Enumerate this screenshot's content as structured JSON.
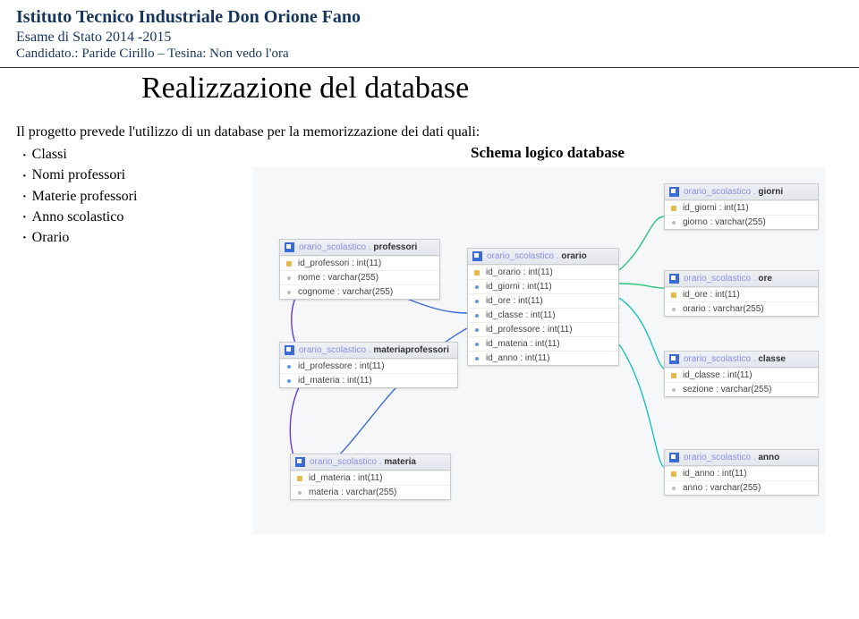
{
  "header": {
    "title": "Istituto Tecnico Industriale Don Orione Fano",
    "line2": "Esame di Stato 2014 -2015",
    "line3": "Candidato.: Paride Cirillo – Tesina: Non vedo l'ora"
  },
  "slide": {
    "title": "Realizzazione del database",
    "intro": "Il progetto prevede l'utilizzo di un database per la memorizzazione dei dati quali:",
    "bullets": [
      "Classi",
      "Nomi professori",
      "Materie professori",
      "Anno scolastico",
      "Orario"
    ],
    "schema_title": "Schema logico database"
  },
  "diagram": {
    "schema": "orario_scolastico .",
    "tables": {
      "giorni": {
        "name": "giorni",
        "cols": [
          {
            "k": "pk",
            "t": "id_giorni : int(11)"
          },
          {
            "k": "col",
            "t": "giorno : varchar(255)"
          }
        ]
      },
      "professori": {
        "name": "professori",
        "cols": [
          {
            "k": "pk",
            "t": "id_professori : int(11)"
          },
          {
            "k": "col",
            "t": "nome : varchar(255)"
          },
          {
            "k": "col",
            "t": "cognome : varchar(255)"
          }
        ]
      },
      "orario": {
        "name": "orario",
        "cols": [
          {
            "k": "pk",
            "t": "id_orario : int(11)"
          },
          {
            "k": "fk",
            "t": "id_giorni : int(11)"
          },
          {
            "k": "fk",
            "t": "id_ore : int(11)"
          },
          {
            "k": "fk",
            "t": "id_classe : int(11)"
          },
          {
            "k": "fk",
            "t": "id_professore : int(11)"
          },
          {
            "k": "fk",
            "t": "id_materia : int(11)"
          },
          {
            "k": "fk",
            "t": "id_anno : int(11)"
          }
        ]
      },
      "ore": {
        "name": "ore",
        "cols": [
          {
            "k": "pk",
            "t": "id_ore : int(11)"
          },
          {
            "k": "col",
            "t": "orario : varchar(255)"
          }
        ]
      },
      "materiaprofessori": {
        "name": "materiaprofessori",
        "cols": [
          {
            "k": "fk",
            "t": "id_professore : int(11)"
          },
          {
            "k": "fk",
            "t": "id_materia : int(11)"
          }
        ]
      },
      "classe": {
        "name": "classe",
        "cols": [
          {
            "k": "pk",
            "t": "id_classe : int(11)"
          },
          {
            "k": "col",
            "t": "sezione : varchar(255)"
          }
        ]
      },
      "materia": {
        "name": "materia",
        "cols": [
          {
            "k": "pk",
            "t": "id_materia : int(11)"
          },
          {
            "k": "col",
            "t": "materia : varchar(255)"
          }
        ]
      },
      "anno": {
        "name": "anno",
        "cols": [
          {
            "k": "pk",
            "t": "id_anno : int(11)"
          },
          {
            "k": "col",
            "t": "anno : varchar(255)"
          }
        ]
      }
    }
  }
}
